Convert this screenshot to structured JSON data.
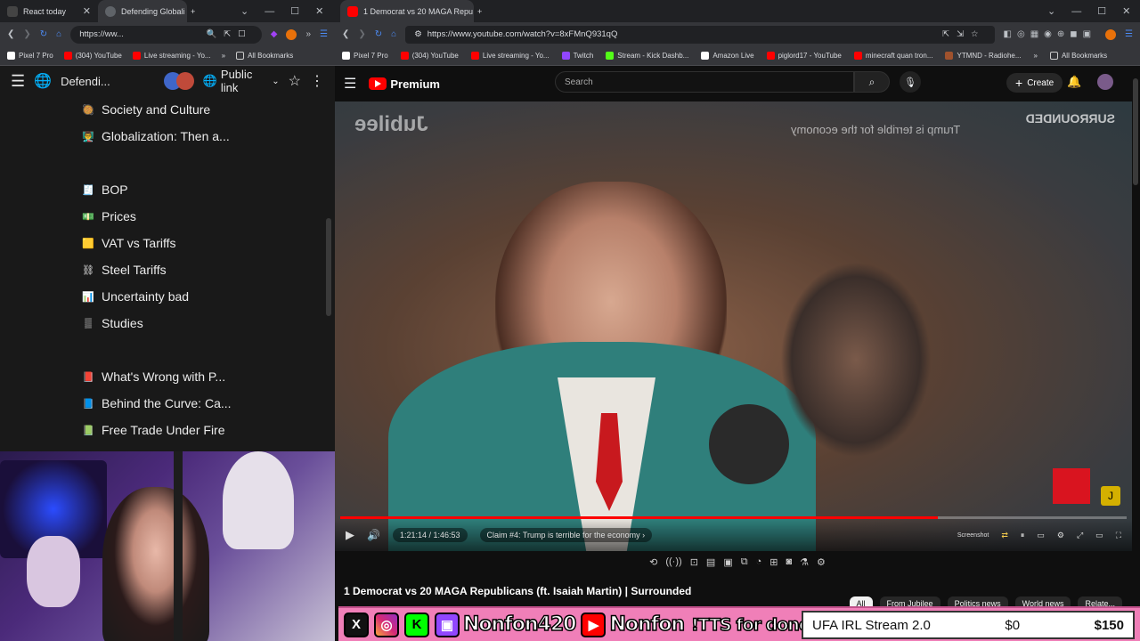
{
  "left_browser": {
    "tabs": [
      {
        "title": "React today"
      },
      {
        "title": "Defending Globali"
      }
    ],
    "url": "https://ww...",
    "bookmarks": [
      "Pixel 7 Pro",
      "(304) YouTube",
      "Live streaming - Yo...",
      "All Bookmarks"
    ],
    "notion": {
      "page_title": "Defendi...",
      "share_label": "Public link",
      "items": [
        {
          "emoji": "🥘",
          "label": "Society and Culture"
        },
        {
          "emoji": "👨‍🏫",
          "label": "Globalization: Then a..."
        },
        {
          "emoji": "",
          "label": ""
        },
        {
          "emoji": "🧾",
          "label": "BOP"
        },
        {
          "emoji": "💵",
          "label": "Prices"
        },
        {
          "emoji": "🟨",
          "label": "VAT vs Tariffs"
        },
        {
          "emoji": "⛓",
          "label": "Steel Tariffs"
        },
        {
          "emoji": "📊",
          "label": "Uncertainty bad"
        },
        {
          "emoji": "▒",
          "label": "Studies"
        },
        {
          "emoji": "",
          "label": ""
        },
        {
          "emoji": "📕",
          "label": "What's Wrong with P..."
        },
        {
          "emoji": "📘",
          "label": "Behind the Curve: Ca..."
        },
        {
          "emoji": "📗",
          "label": "Free Trade Under Fire"
        }
      ]
    }
  },
  "right_browser": {
    "tab_title": "1 Democrat vs 20 MAGA Repu",
    "url": "https://www.youtube.com/watch?v=8xFMnQ931qQ",
    "bookmarks": [
      "Pixel 7 Pro",
      "(304) YouTube",
      "Live streaming - Yo...",
      "Twitch",
      "Stream - Kick Dashb...",
      "Amazon Live",
      "piglord17 - YouTube",
      "minecraft quan tron...",
      "YTMND - Radiohe...",
      "All Bookmarks"
    ],
    "youtube": {
      "logo_text": "Premium",
      "search_placeholder": "Search",
      "create_label": "Create",
      "video": {
        "watermark_left": "Jubilee",
        "overlay_caption": "Trump is terrible for the economy",
        "watermark_right": "SURROUNDED",
        "time": "1:21:14 / 1:46:53",
        "chapter": "Claim #4: Trump is terrible for the economy",
        "screenshot_label": "Screenshot",
        "progress": 0.76
      },
      "title": "1 Democrat vs 20 MAGA Republicans (ft. Isaiah Martin) | Surrounded",
      "chips": [
        "All",
        "From Jubilee",
        "Politics news",
        "World news",
        "Relate..."
      ]
    }
  },
  "overlay": {
    "handle1": "Nonfon420",
    "handle2": "Nonfon",
    "tts_text": "!TTS for dono link",
    "goal_title": "UFA IRL Stream 2.0",
    "goal_current": "$0",
    "goal_target": "$150"
  }
}
